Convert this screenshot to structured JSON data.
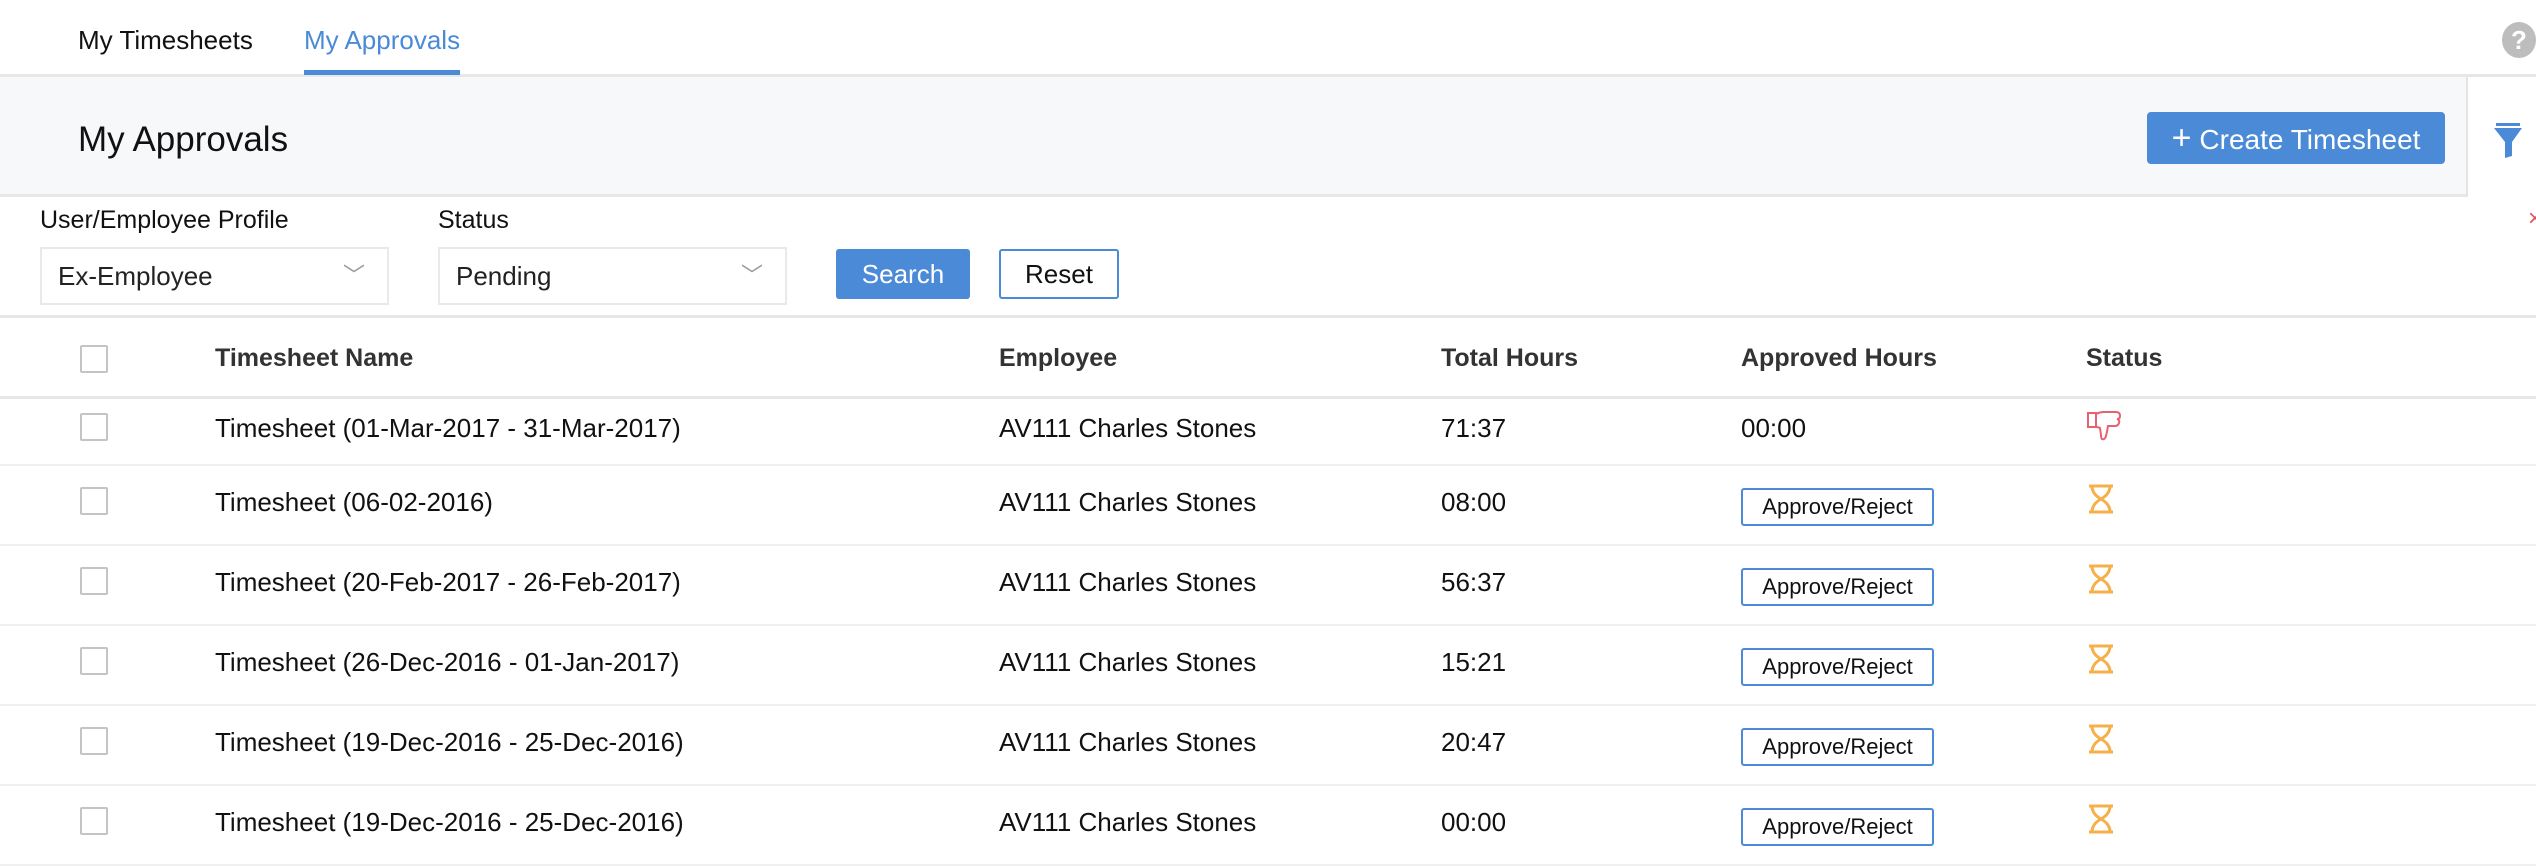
{
  "tabs": [
    {
      "label": "My Timesheets",
      "active": false
    },
    {
      "label": "My Approvals",
      "active": true
    }
  ],
  "help_icon": "?",
  "header": {
    "title": "My Approvals",
    "create_label": "Create Timesheet",
    "create_icon": "+"
  },
  "filters": {
    "profile": {
      "label": "User/Employee Profile",
      "value": "Ex-Employee"
    },
    "status": {
      "label": "Status",
      "value": "Pending"
    },
    "search_label": "Search",
    "reset_label": "Reset",
    "close_icon": "×"
  },
  "colors": {
    "accent": "#4a8ad6",
    "rejected": "#e8616f",
    "pending": "#f5b04a"
  },
  "table": {
    "columns": [
      "Timesheet Name",
      "Employee",
      "Total Hours",
      "Approved Hours",
      "Status"
    ],
    "rows": [
      {
        "name": "Timesheet (01-Mar-2017 - 31-Mar-2017)",
        "employee": "AV111 Charles Stones",
        "total": "71:37",
        "approved": "00:00",
        "status": "rejected"
      },
      {
        "name": "Timesheet (06-02-2016)",
        "employee": "AV111 Charles Stones",
        "total": "08:00",
        "approved": "Approve/Reject",
        "status": "pending"
      },
      {
        "name": "Timesheet (20-Feb-2017 - 26-Feb-2017)",
        "employee": "AV111 Charles Stones",
        "total": "56:37",
        "approved": "Approve/Reject",
        "status": "pending"
      },
      {
        "name": "Timesheet (26-Dec-2016 - 01-Jan-2017)",
        "employee": "AV111 Charles Stones",
        "total": "15:21",
        "approved": "Approve/Reject",
        "status": "pending"
      },
      {
        "name": "Timesheet (19-Dec-2016 - 25-Dec-2016)",
        "employee": "AV111 Charles Stones",
        "total": "20:47",
        "approved": "Approve/Reject",
        "status": "pending"
      },
      {
        "name": "Timesheet (19-Dec-2016 - 25-Dec-2016)",
        "employee": "AV111 Charles Stones",
        "total": "00:00",
        "approved": "Approve/Reject",
        "status": "pending"
      }
    ]
  }
}
